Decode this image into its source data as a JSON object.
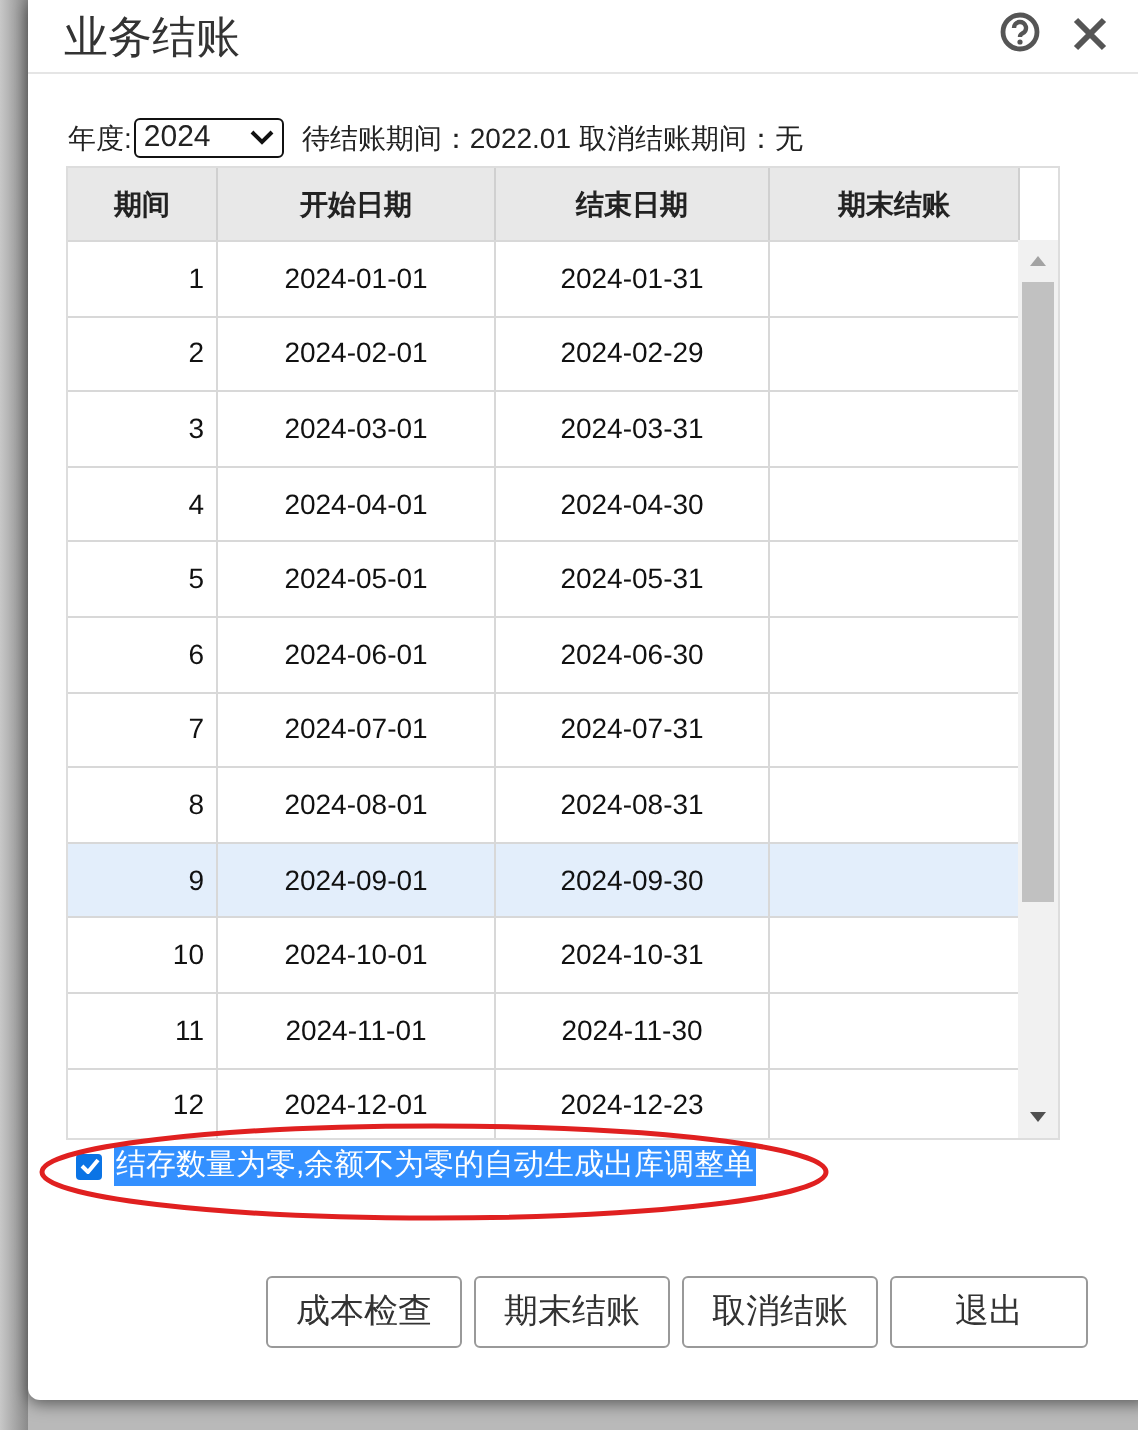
{
  "dialog": {
    "title": "业务结账"
  },
  "filter": {
    "year_label": "年度:",
    "year": "2024",
    "pending_period": "待结账期间：2022.01",
    "cancel_period": "取消结账期间：无"
  },
  "table": {
    "columns": [
      "期间",
      "开始日期",
      "结束日期",
      "期末结账"
    ],
    "rows": [
      {
        "cells": [
          "1",
          "2024-01-01",
          "2024-01-31",
          ""
        ],
        "selected": false
      },
      {
        "cells": [
          "2",
          "2024-02-01",
          "2024-02-29",
          ""
        ],
        "selected": false
      },
      {
        "cells": [
          "3",
          "2024-03-01",
          "2024-03-31",
          ""
        ],
        "selected": false
      },
      {
        "cells": [
          "4",
          "2024-04-01",
          "2024-04-30",
          ""
        ],
        "selected": false
      },
      {
        "cells": [
          "5",
          "2024-05-01",
          "2024-05-31",
          ""
        ],
        "selected": false
      },
      {
        "cells": [
          "6",
          "2024-06-01",
          "2024-06-30",
          ""
        ],
        "selected": false
      },
      {
        "cells": [
          "7",
          "2024-07-01",
          "2024-07-31",
          ""
        ],
        "selected": false
      },
      {
        "cells": [
          "8",
          "2024-08-01",
          "2024-08-31",
          ""
        ],
        "selected": false
      },
      {
        "cells": [
          "9",
          "2024-09-01",
          "2024-09-30",
          ""
        ],
        "selected": true
      },
      {
        "cells": [
          "10",
          "2024-10-01",
          "2024-10-31",
          ""
        ],
        "selected": false
      },
      {
        "cells": [
          "11",
          "2024-11-01",
          "2024-11-30",
          ""
        ],
        "selected": false
      },
      {
        "cells": [
          "12",
          "2024-12-01",
          "2024-12-23",
          ""
        ],
        "selected": false
      }
    ]
  },
  "option": {
    "label": "结存数量为零,余额不为零的自动生成出库调整单",
    "checked": true,
    "highlighted": true
  },
  "buttons": [
    "成本检查",
    "期末结账",
    "取消结账",
    "退出"
  ]
}
